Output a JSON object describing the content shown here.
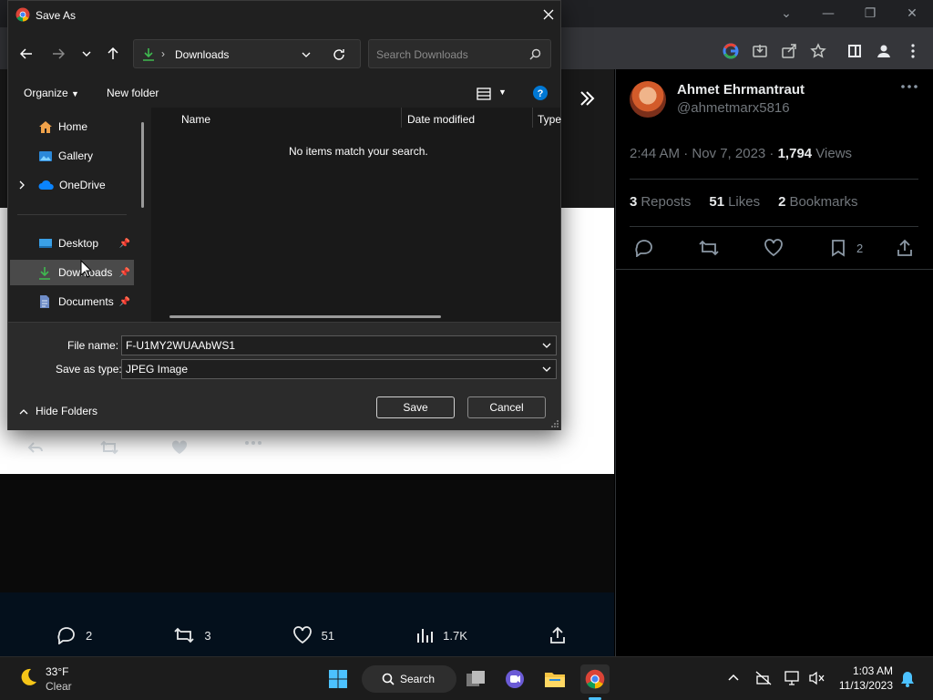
{
  "browser": {
    "window_controls": {
      "tab_search": "⌄",
      "minimize": "—",
      "restore": "❐",
      "close": "✕"
    }
  },
  "tweet": {
    "author_name": "Ahmet Ehrmantraut",
    "author_handle": "@ahmetmarx5816",
    "meta": {
      "time": "2:44 AM · Nov 7, 2023 · ",
      "views_count": "1,794",
      "views_label": " Views"
    },
    "stats": {
      "reposts_count": "3",
      "reposts_label": "Reposts",
      "likes_count": "51",
      "likes_label": "Likes",
      "bookmarks_count": "2",
      "bookmarks_label": "Bookmarks"
    },
    "actions_bookmark_count": "2"
  },
  "feed_actions": {
    "replies": "2",
    "reposts": "3",
    "likes": "51",
    "views": "1.7K"
  },
  "dialog": {
    "title": "Save As",
    "address_folder": "Downloads",
    "search_placeholder": "Search Downloads",
    "organize": "Organize",
    "new_folder": "New folder",
    "nav_items": [
      {
        "label": "Home"
      },
      {
        "label": "Gallery"
      },
      {
        "label": "OneDrive"
      },
      {
        "label": "Desktop"
      },
      {
        "label": "Downloads"
      },
      {
        "label": "Documents"
      }
    ],
    "columns": {
      "name": "Name",
      "date_modified": "Date modified",
      "type": "Type"
    },
    "empty_message": "No items match your search.",
    "file_name_label": "File name:",
    "file_name_value": "F-U1MY2WUAAbWS1",
    "save_type_label": "Save as type:",
    "save_type_value": "JPEG Image",
    "hide_folders": "Hide Folders",
    "save_button": "Save",
    "cancel_button": "Cancel"
  },
  "taskbar": {
    "weather_temp": "33°F",
    "weather_desc": "Clear",
    "search_label": "Search",
    "time": "1:03 AM",
    "date": "11/13/2023"
  },
  "colors": {
    "accent_blue": "#0078d4",
    "download_green": "#3fb950",
    "x_gray": "#71767b"
  }
}
